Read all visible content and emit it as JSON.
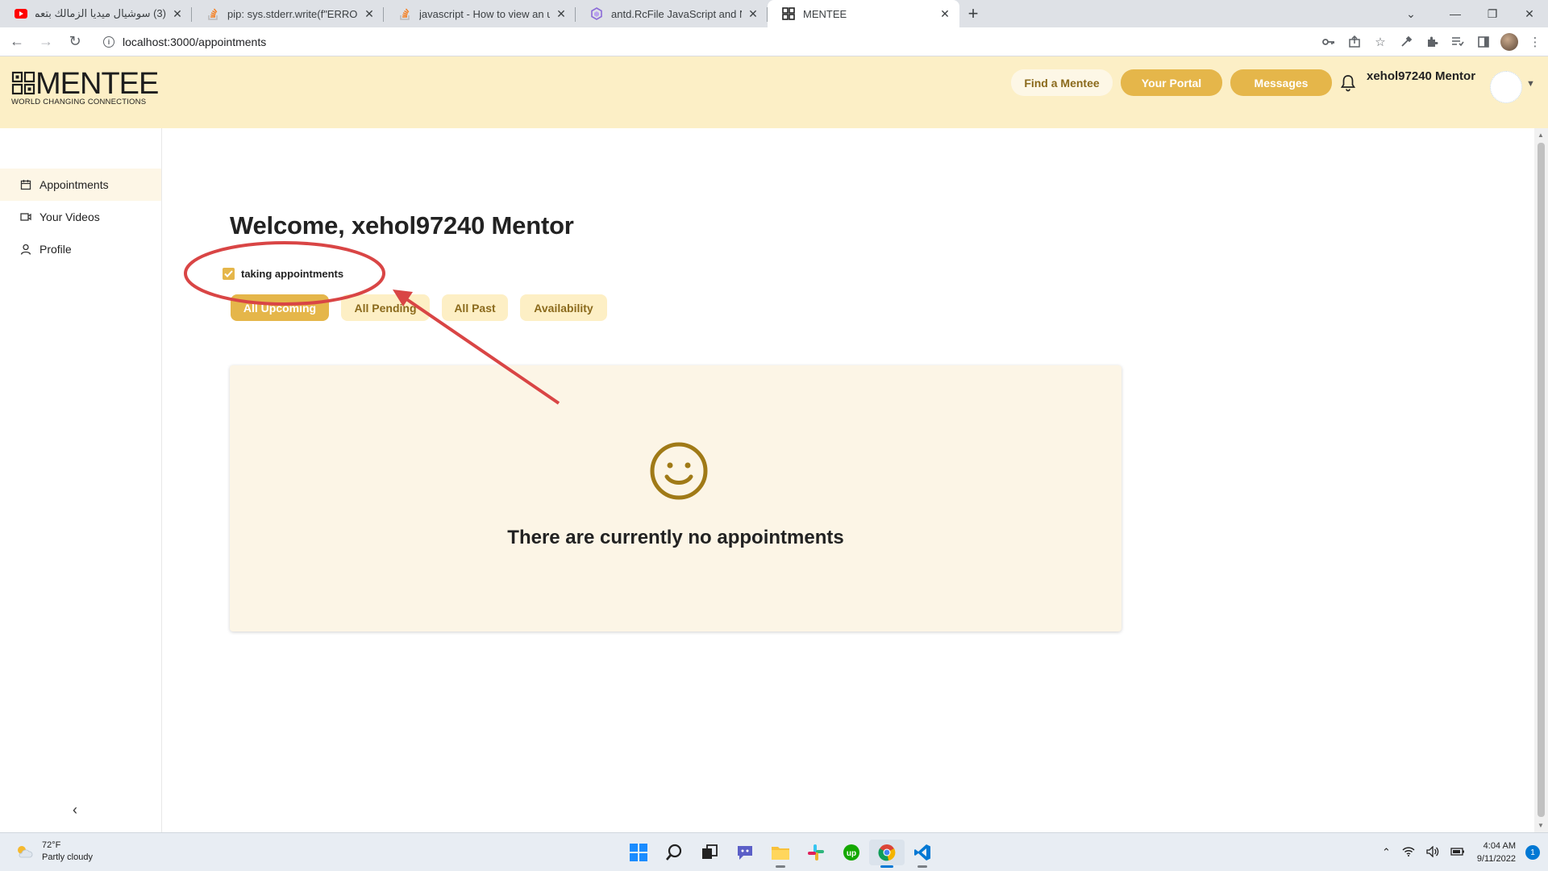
{
  "browser": {
    "tabs": [
      {
        "label": "(3) سوشيال ميديا الزمالك بتعمل عـ",
        "favicon": "youtube-icon",
        "active": false
      },
      {
        "label": "pip: sys.stderr.write(f\"ERROR: {ex",
        "favicon": "stackoverflow-icon",
        "active": false
      },
      {
        "label": "javascript - How to view an uplo",
        "favicon": "stackoverflow-icon",
        "active": false
      },
      {
        "label": "antd.RcFile JavaScript and Node.j",
        "favicon": "tabnine-icon",
        "active": false
      },
      {
        "label": "MENTEE",
        "favicon": "mentee-icon",
        "active": true
      }
    ],
    "url": "localhost:3000/appointments"
  },
  "header": {
    "logo_word": "MENTEE",
    "logo_tagline": "WORLD CHANGING CONNECTIONS",
    "find_label": "Find a Mentee",
    "portal_label": "Your Portal",
    "messages_label": "Messages",
    "username": "xehol97240 Mentor"
  },
  "sidebar": {
    "items": [
      {
        "label": "Appointments",
        "icon": "calendar-icon",
        "active": true
      },
      {
        "label": "Your Videos",
        "icon": "video-icon",
        "active": false
      },
      {
        "label": "Profile",
        "icon": "user-icon",
        "active": false
      }
    ]
  },
  "main": {
    "welcome": "Welcome, xehol97240 Mentor",
    "taking_label": "taking appointments",
    "taking_checked": true,
    "filters": [
      {
        "label": "All Upcoming",
        "active": true
      },
      {
        "label": "All Pending",
        "active": false
      },
      {
        "label": "All Past",
        "active": false
      },
      {
        "label": "Availability",
        "active": false
      }
    ],
    "empty_text": "There are currently no appointments"
  },
  "taskbar": {
    "temp": "72°F",
    "condition": "Partly cloudy",
    "time": "4:04 AM",
    "date": "9/11/2022",
    "notifications": "1"
  },
  "colors": {
    "header_bg": "#fcefc6",
    "gold": "#e5b64a",
    "card_bg": "#fcf5e6",
    "smiley": "#a07a17",
    "annotation": "#d94545"
  }
}
